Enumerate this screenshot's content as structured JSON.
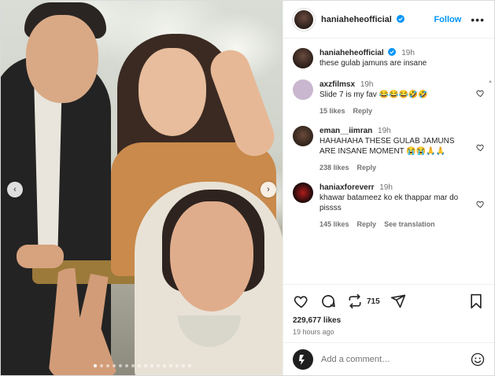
{
  "post": {
    "author": "haniaheheofficial",
    "follow_label": "Follow",
    "more_label": "•••",
    "caption": {
      "user": "haniaheheofficial",
      "time": "19h",
      "text": "these gulab jamuns are insane"
    },
    "comments": [
      {
        "user": "axzfilmsx",
        "time": "19h",
        "text": "Slide 7 is my fav 😂😂😂🤣🤣",
        "likes": "15 likes",
        "reply": "Reply",
        "translation": ""
      },
      {
        "user": "eman__iimran",
        "time": "19h",
        "text": "HAHAHAHA THESE GULAB JAMUNS ARE INSANE MOMENT 😭😭🙏🙏",
        "likes": "238 likes",
        "reply": "Reply",
        "translation": ""
      },
      {
        "user": "haniaxforeverr",
        "time": "19h",
        "text": "khawar batameez ko ek thappar mar do pissss",
        "likes": "145 likes",
        "reply": "Reply",
        "translation": "See translation"
      }
    ],
    "repost_count": "715",
    "likes": "229,677 likes",
    "time_ago": "19 hours ago",
    "comment_placeholder": "Add a comment…",
    "carousel": {
      "prev": "‹",
      "next": "›",
      "slide_count": 16,
      "active_index": 0
    }
  },
  "colors": {
    "accent": "#0095f6",
    "verified": "#0095f6",
    "text": "#262626",
    "muted": "#737373"
  },
  "icons": {
    "like": "heart-icon",
    "comment": "comment-icon",
    "repost": "repost-icon",
    "share": "share-icon",
    "save": "bookmark-icon",
    "emoji": "emoji-icon"
  }
}
